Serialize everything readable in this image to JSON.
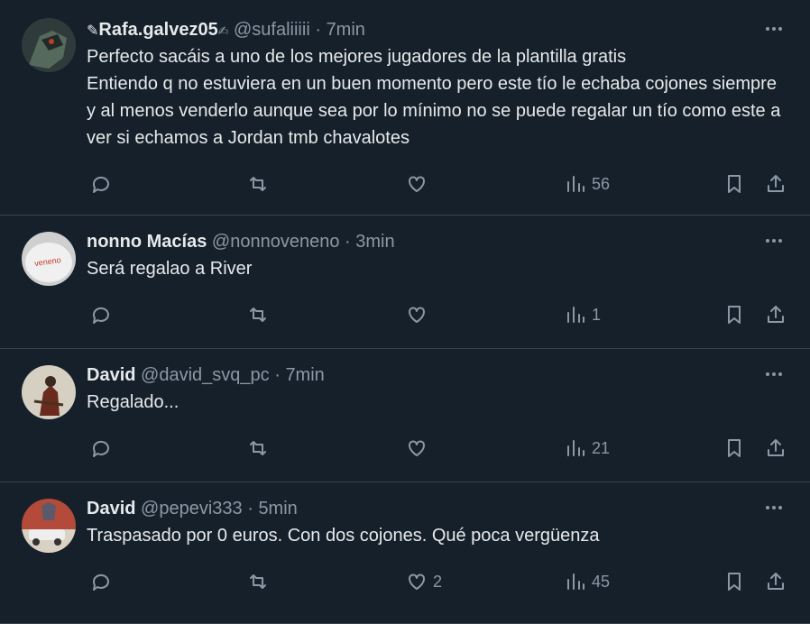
{
  "tweets": [
    {
      "name": "Rafa.galvez05",
      "name_prefix": "✎",
      "name_suffix": "✍",
      "handle": "@sufaliiiii",
      "time": "7min",
      "text": "Perfecto sacáis a uno de los mejores jugadores de la plantilla gratis\nEntiendo q no estuviera en un buen momento pero este tío le echaba cojones siempre y al menos venderlo aunque sea por lo mínimo no se puede regalar un tío como este a ver si echamos a Jordan tmb chavalotes",
      "likes": "",
      "views": "56",
      "avatar_color": "#3a4a3a"
    },
    {
      "name": "nonno Macías",
      "handle": "@nonnoveneno",
      "time": "3min",
      "text": "Será regalao a River",
      "likes": "",
      "views": "1",
      "avatar_color": "#d9d9d9"
    },
    {
      "name": "David",
      "handle": "@david_svq_pc",
      "time": "7min",
      "text": "Regalado...",
      "likes": "",
      "views": "21",
      "avatar_color": "#c9c2b0"
    },
    {
      "name": "David",
      "handle": "@pepevi333",
      "time": "5min",
      "text": "Traspasado por 0 euros. Con dos cojones. Qué poca vergüenza",
      "likes": "2",
      "views": "45",
      "avatar_color": "#a83a2a"
    }
  ],
  "separator": "·"
}
